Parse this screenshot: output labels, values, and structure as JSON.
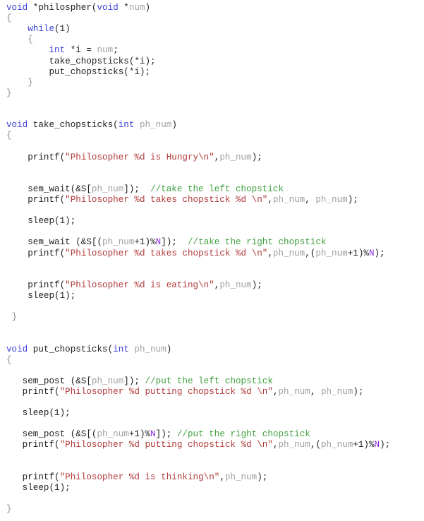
{
  "document": {
    "language": "C",
    "lines": [
      [
        [
          "kw",
          "void"
        ],
        [
          "t",
          " *philospher("
        ],
        [
          "kw",
          "void"
        ],
        [
          "t",
          " *"
        ],
        [
          "id",
          "num"
        ],
        [
          "t",
          ")"
        ]
      ],
      [
        [
          "br",
          "{"
        ]
      ],
      [
        [
          "t",
          "    "
        ],
        [
          "kw",
          "while"
        ],
        [
          "t",
          "(1)"
        ]
      ],
      [
        [
          "t",
          "    "
        ],
        [
          "br",
          "{"
        ]
      ],
      [
        [
          "t",
          "        "
        ],
        [
          "kw",
          "int"
        ],
        [
          "t",
          " *i = "
        ],
        [
          "id",
          "num"
        ],
        [
          "t",
          ";"
        ]
      ],
      [
        [
          "t",
          "        take_chopsticks(*i);"
        ]
      ],
      [
        [
          "t",
          "        put_chopsticks(*i);"
        ]
      ],
      [
        [
          "t",
          "    "
        ],
        [
          "br",
          "}"
        ]
      ],
      [
        [
          "br",
          "}"
        ]
      ],
      [],
      [],
      [
        [
          "kw",
          "void"
        ],
        [
          "t",
          " take_chopsticks("
        ],
        [
          "kw",
          "int"
        ],
        [
          "t",
          " "
        ],
        [
          "id",
          "ph_num"
        ],
        [
          "t",
          ")"
        ]
      ],
      [
        [
          "br",
          "{"
        ]
      ],
      [],
      [
        [
          "t",
          "    printf("
        ],
        [
          "str",
          "\"Philosopher %d is Hungry\\n\""
        ],
        [
          "t",
          ","
        ],
        [
          "id",
          "ph_num"
        ],
        [
          "t",
          ");"
        ]
      ],
      [],
      [],
      [
        [
          "t",
          "    sem_wait(&S["
        ],
        [
          "id",
          "ph_num"
        ],
        [
          "t",
          "]);  "
        ],
        [
          "cm",
          "//take the left chopstick"
        ]
      ],
      [
        [
          "t",
          "    printf("
        ],
        [
          "str",
          "\"Philosopher %d takes chopstick %d \\n\""
        ],
        [
          "t",
          ","
        ],
        [
          "id",
          "ph_num"
        ],
        [
          "t",
          ", "
        ],
        [
          "id",
          "ph_num"
        ],
        [
          "t",
          ");"
        ]
      ],
      [],
      [
        [
          "t",
          "    sleep(1);"
        ]
      ],
      [],
      [
        [
          "t",
          "    sem_wait (&S[("
        ],
        [
          "id",
          "ph_num"
        ],
        [
          "t",
          "+1)%"
        ],
        [
          "mac",
          "N"
        ],
        [
          "t",
          "]);  "
        ],
        [
          "cm",
          "//take the right chopstick"
        ]
      ],
      [
        [
          "t",
          "    printf("
        ],
        [
          "str",
          "\"Philosopher %d takes chopstick %d \\n\""
        ],
        [
          "t",
          ","
        ],
        [
          "id",
          "ph_num"
        ],
        [
          "t",
          ",("
        ],
        [
          "id",
          "ph_num"
        ],
        [
          "t",
          "+1)%"
        ],
        [
          "mac",
          "N"
        ],
        [
          "t",
          ");"
        ]
      ],
      [],
      [],
      [
        [
          "t",
          "    printf("
        ],
        [
          "str",
          "\"Philosopher %d is eating\\n\""
        ],
        [
          "t",
          ","
        ],
        [
          "id",
          "ph_num"
        ],
        [
          "t",
          ");"
        ]
      ],
      [
        [
          "t",
          "    sleep(1);"
        ]
      ],
      [],
      [
        [
          "t",
          " "
        ],
        [
          "br",
          "}"
        ]
      ],
      [],
      [],
      [
        [
          "kw",
          "void"
        ],
        [
          "t",
          " put_chopsticks("
        ],
        [
          "kw",
          "int"
        ],
        [
          "t",
          " "
        ],
        [
          "id",
          "ph_num"
        ],
        [
          "t",
          ")"
        ]
      ],
      [
        [
          "br",
          "{"
        ]
      ],
      [],
      [
        [
          "t",
          "   sem_post (&S["
        ],
        [
          "id",
          "ph_num"
        ],
        [
          "t",
          "]); "
        ],
        [
          "cm",
          "//put the left chopstick"
        ]
      ],
      [
        [
          "t",
          "   printf("
        ],
        [
          "str",
          "\"Philosopher %d putting chopstick %d \\n\""
        ],
        [
          "t",
          ","
        ],
        [
          "id",
          "ph_num"
        ],
        [
          "t",
          ", "
        ],
        [
          "id",
          "ph_num"
        ],
        [
          "t",
          ");"
        ]
      ],
      [],
      [
        [
          "t",
          "   sleep(1);"
        ]
      ],
      [],
      [
        [
          "t",
          "   sem_post (&S[("
        ],
        [
          "id",
          "ph_num"
        ],
        [
          "t",
          "+1)%"
        ],
        [
          "mac",
          "N"
        ],
        [
          "t",
          "]); "
        ],
        [
          "cm",
          "//put the right chopstick"
        ]
      ],
      [
        [
          "t",
          "   printf("
        ],
        [
          "str",
          "\"Philosopher %d putting chopstick %d \\n\""
        ],
        [
          "t",
          ","
        ],
        [
          "id",
          "ph_num"
        ],
        [
          "t",
          ",("
        ],
        [
          "id",
          "ph_num"
        ],
        [
          "t",
          "+1)%"
        ],
        [
          "mac",
          "N"
        ],
        [
          "t",
          ");"
        ]
      ],
      [],
      [],
      [
        [
          "t",
          "   printf("
        ],
        [
          "str",
          "\"Philosopher %d is thinking\\n\""
        ],
        [
          "t",
          ","
        ],
        [
          "id",
          "ph_num"
        ],
        [
          "t",
          ");"
        ]
      ],
      [
        [
          "t",
          "   sleep(1);"
        ]
      ],
      [],
      [
        [
          "br",
          "}"
        ]
      ]
    ]
  }
}
